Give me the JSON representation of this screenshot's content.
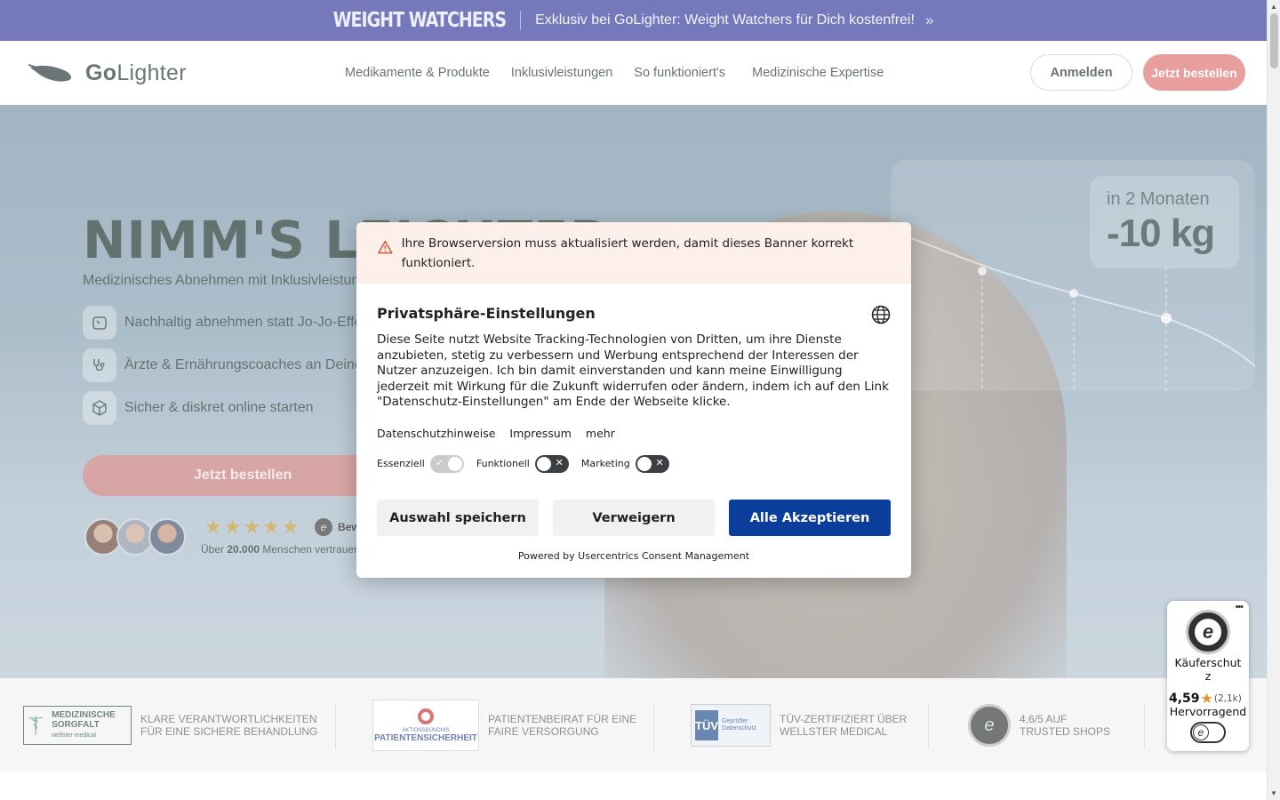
{
  "promo": {
    "brand": "WEIGHT WATCHERS",
    "text": "Exklusiv bei GoLighter: Weight Watchers für Dich kostenfrei!",
    "chevron": "»"
  },
  "header": {
    "logo_prefix": "Go",
    "logo_suffix": "Lighter",
    "nav": [
      "Medikamente & Produkte",
      "Inklusivleistungen",
      "So funktioniert's",
      "Medizinische Expertise"
    ],
    "login_label": "Anmelden",
    "order_label": "Jetzt bestellen"
  },
  "hero": {
    "title_bold": "NIMM'S",
    "title_light": "LEICHTER",
    "subtitle": "Medizinisches Abnehmen mit Inklusivleistungen",
    "bullets": [
      {
        "icon": "scale-icon",
        "text": "Nachhaltig abnehmen statt Jo-Jo-Effekt"
      },
      {
        "icon": "stethoscope-icon",
        "text": "Ärzte & Ernährungscoaches an Deiner Seite"
      },
      {
        "icon": "package-icon",
        "text": "Sicher & diskret online starten"
      }
    ],
    "cta_label": "Jetzt bestellen",
    "stars": "★★★★★",
    "rating_label": "Bewertungen",
    "trusted_prefix": "Über ",
    "trusted_count": "20.000",
    "trusted_suffix": " Menschen vertrauen uns",
    "stats_top": "in 2  Monaten",
    "stats_value": "-10 kg"
  },
  "trustbar": {
    "items": [
      {
        "badge": "MEDIZINISCHE SORGFALT",
        "badge_sub": "wellster medical",
        "text_1": "KLARE VERANTWORTLICHKEITEN",
        "text_2": "FÜR EINE SICHERE BEHANDLUNG"
      },
      {
        "badge": "PATIENTENSICHERHEIT",
        "badge_sub": "AKTIONSBÜNDNIS",
        "text_1": "PATIENTENBEIRAT FÜR EINE",
        "text_2": "FAIRE VERSORGUNG"
      },
      {
        "badge": "TÜV SAARLAND",
        "badge_sub": "Geprüfter Datenschutz",
        "text_1": "TÜV-ZERTIFIZIERT ÜBER",
        "text_2": "WELLSTER MEDICAL"
      },
      {
        "badge": "e",
        "badge_sub": "TRUSTED SHOPS",
        "text_1": "4,6/5 AUF",
        "text_2": "TRUSTED SHOPS"
      }
    ]
  },
  "consent": {
    "warning": "Ihre Browserversion muss aktualisiert werden, damit dieses Banner korrekt funktioniert.",
    "title": "Privatsphäre-Einstellungen",
    "description": "Diese Seite nutzt Website Tracking-Technologien von Dritten, um ihre Dienste anzubieten, stetig zu verbessern und Werbung entsprechend der Interessen der Nutzer anzuzeigen. Ich bin damit einverstanden und kann meine Einwilligung jederzeit mit Wirkung für die Zukunft widerrufen oder ändern, indem ich auf den Link \"Datenschutz-Einstellungen\" am Ende der Webseite klicke.",
    "links": [
      "Datenschutzhinweise",
      "Impressum",
      "mehr"
    ],
    "toggles": [
      {
        "label": "Essenziell",
        "state": "on-locked"
      },
      {
        "label": "Funktionell",
        "state": "off"
      },
      {
        "label": "Marketing",
        "state": "off"
      }
    ],
    "btn_save": "Auswahl speichern",
    "btn_deny": "Verweigern",
    "btn_accept": "Alle Akzeptieren",
    "powered": "Powered by Usercentrics Consent Management",
    "accent_color": "#0b3d9c"
  },
  "trusted_shops_widget": {
    "title": "Käuferschutz",
    "rating": "4,59",
    "count": "(2,1k)",
    "label": "Hervorragend",
    "menu": "•••"
  },
  "colors": {
    "promo_bg": "#3a3f9e",
    "cta": "#e07575",
    "consent_blue": "#0b3d9c"
  }
}
